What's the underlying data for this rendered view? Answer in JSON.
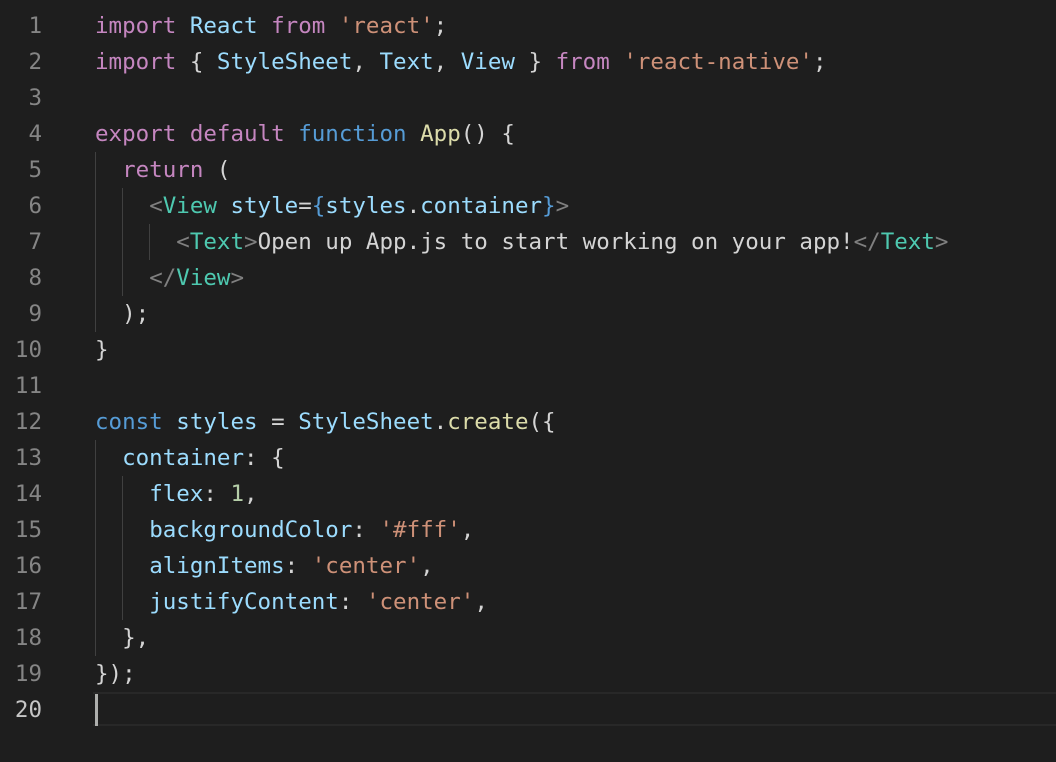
{
  "editor": {
    "language": "javascript",
    "active_line": 20,
    "lines": [
      {
        "n": "1",
        "tokens": [
          [
            "k",
            "import"
          ],
          [
            "p",
            " "
          ],
          [
            "v",
            "React"
          ],
          [
            "p",
            " "
          ],
          [
            "k",
            "from"
          ],
          [
            "p",
            " "
          ],
          [
            "s",
            "'react'"
          ],
          [
            "p",
            ";"
          ]
        ]
      },
      {
        "n": "2",
        "tokens": [
          [
            "k",
            "import"
          ],
          [
            "p",
            " { "
          ],
          [
            "v",
            "StyleSheet"
          ],
          [
            "p",
            ", "
          ],
          [
            "v",
            "Text"
          ],
          [
            "p",
            ", "
          ],
          [
            "v",
            "View"
          ],
          [
            "p",
            " } "
          ],
          [
            "k",
            "from"
          ],
          [
            "p",
            " "
          ],
          [
            "s",
            "'react-native'"
          ],
          [
            "p",
            ";"
          ]
        ]
      },
      {
        "n": "3",
        "tokens": []
      },
      {
        "n": "4",
        "tokens": [
          [
            "k",
            "export"
          ],
          [
            "p",
            " "
          ],
          [
            "k",
            "default"
          ],
          [
            "p",
            " "
          ],
          [
            "b",
            "function"
          ],
          [
            "p",
            " "
          ],
          [
            "f",
            "App"
          ],
          [
            "p",
            "() {"
          ]
        ]
      },
      {
        "n": "5",
        "tokens": [
          [
            "p",
            "  "
          ],
          [
            "k",
            "return"
          ],
          [
            "p",
            " ("
          ]
        ]
      },
      {
        "n": "6",
        "tokens": [
          [
            "p",
            "    "
          ],
          [
            "g",
            "<"
          ],
          [
            "t",
            "View"
          ],
          [
            "p",
            " "
          ],
          [
            "v",
            "style"
          ],
          [
            "p",
            "="
          ],
          [
            "b",
            "{"
          ],
          [
            "v",
            "styles"
          ],
          [
            "p",
            "."
          ],
          [
            "v",
            "container"
          ],
          [
            "b",
            "}"
          ],
          [
            "g",
            ">"
          ]
        ]
      },
      {
        "n": "7",
        "tokens": [
          [
            "p",
            "      "
          ],
          [
            "g",
            "<"
          ],
          [
            "t",
            "Text"
          ],
          [
            "g",
            ">"
          ],
          [
            "p",
            "Open up App.js to start working on your app!"
          ],
          [
            "g",
            "</"
          ],
          [
            "t",
            "Text"
          ],
          [
            "g",
            ">"
          ]
        ]
      },
      {
        "n": "8",
        "tokens": [
          [
            "p",
            "    "
          ],
          [
            "g",
            "</"
          ],
          [
            "t",
            "View"
          ],
          [
            "g",
            ">"
          ]
        ]
      },
      {
        "n": "9",
        "tokens": [
          [
            "p",
            "  );"
          ]
        ]
      },
      {
        "n": "10",
        "tokens": [
          [
            "p",
            "}"
          ]
        ]
      },
      {
        "n": "11",
        "tokens": []
      },
      {
        "n": "12",
        "tokens": [
          [
            "b",
            "const"
          ],
          [
            "p",
            " "
          ],
          [
            "v",
            "styles"
          ],
          [
            "p",
            " = "
          ],
          [
            "v",
            "StyleSheet"
          ],
          [
            "p",
            "."
          ],
          [
            "f",
            "create"
          ],
          [
            "p",
            "({"
          ]
        ]
      },
      {
        "n": "13",
        "tokens": [
          [
            "p",
            "  "
          ],
          [
            "v",
            "container"
          ],
          [
            "p",
            ": {"
          ]
        ]
      },
      {
        "n": "14",
        "tokens": [
          [
            "p",
            "    "
          ],
          [
            "v",
            "flex"
          ],
          [
            "p",
            ": "
          ],
          [
            "n",
            "1"
          ],
          [
            "p",
            ","
          ]
        ]
      },
      {
        "n": "15",
        "tokens": [
          [
            "p",
            "    "
          ],
          [
            "v",
            "backgroundColor"
          ],
          [
            "p",
            ": "
          ],
          [
            "s",
            "'#fff'"
          ],
          [
            "p",
            ","
          ]
        ]
      },
      {
        "n": "16",
        "tokens": [
          [
            "p",
            "    "
          ],
          [
            "v",
            "alignItems"
          ],
          [
            "p",
            ": "
          ],
          [
            "s",
            "'center'"
          ],
          [
            "p",
            ","
          ]
        ]
      },
      {
        "n": "17",
        "tokens": [
          [
            "p",
            "    "
          ],
          [
            "v",
            "justifyContent"
          ],
          [
            "p",
            ": "
          ],
          [
            "s",
            "'center'"
          ],
          [
            "p",
            ","
          ]
        ]
      },
      {
        "n": "18",
        "tokens": [
          [
            "p",
            "  },"
          ]
        ]
      },
      {
        "n": "19",
        "tokens": [
          [
            "p",
            "});"
          ]
        ]
      },
      {
        "n": "20",
        "tokens": []
      }
    ]
  }
}
